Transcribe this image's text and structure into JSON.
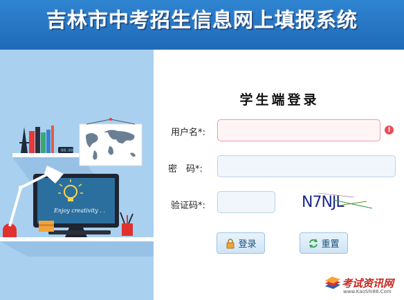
{
  "header": {
    "title": "吉林市中考招生信息网上填报系统"
  },
  "illustration": {
    "screen_text": "Enjoy creativity . ."
  },
  "login": {
    "title": "学生端登录",
    "username_label": "用户名*:",
    "username_value": "",
    "password_label": "密　码*:",
    "password_value": "",
    "captcha_label": "验证码*:",
    "captcha_value": "",
    "captcha_text": "N7NJL",
    "error_icon": "!",
    "login_button": "登录",
    "reset_button": "重置"
  },
  "watermark": {
    "text": "考试资讯网",
    "url": "www.KaoShi86.Com"
  },
  "colors": {
    "header": "#2a7bc8",
    "panel": "#a9d0ef",
    "error": "#ec4c58",
    "button_text": "#1a4f7a"
  }
}
